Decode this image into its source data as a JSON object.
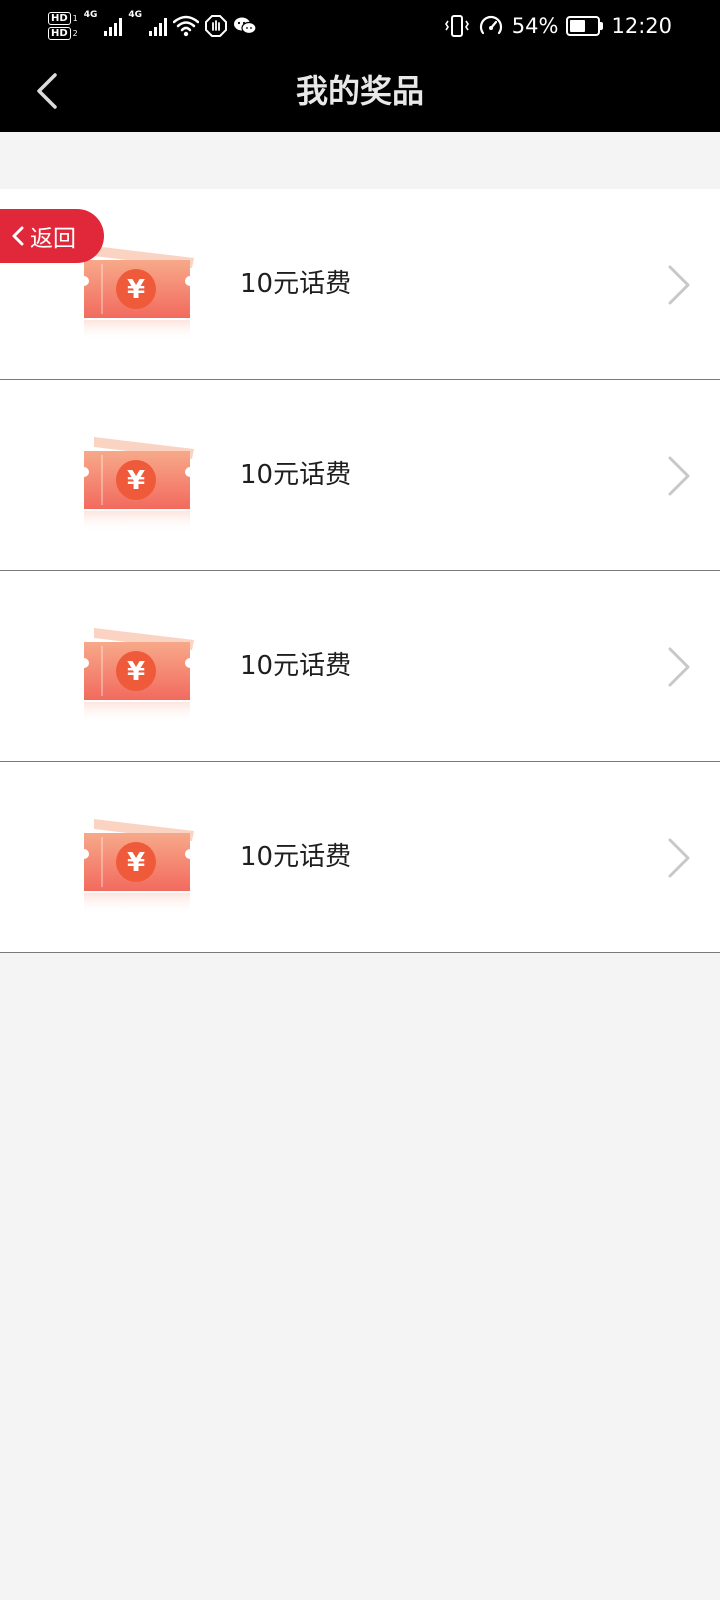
{
  "status_bar": {
    "hd1": "HD",
    "hd1_sim": "1",
    "hd2": "HD",
    "hd2_sim": "2",
    "net1": "4G",
    "net2": "4G",
    "battery_percent": "54%",
    "battery_level": 0.54,
    "time": "12:20"
  },
  "header": {
    "title": "我的奖品",
    "back_icon": "chevron-left-icon"
  },
  "float_button": {
    "label": "返回",
    "icon": "chevron-left-icon"
  },
  "prizes": [
    {
      "name": "10元话费",
      "icon": "ticket-icon",
      "currency_symbol": "¥"
    },
    {
      "name": "10元话费",
      "icon": "ticket-icon",
      "currency_symbol": "¥"
    },
    {
      "name": "10元话费",
      "icon": "ticket-icon",
      "currency_symbol": "¥"
    },
    {
      "name": "10元话费",
      "icon": "ticket-icon",
      "currency_symbol": "¥"
    }
  ],
  "colors": {
    "header_bg": "#000000",
    "page_bg": "#f4f4f4",
    "accent_red": "#e1283a",
    "ticket_orange": "#f58a6a"
  }
}
